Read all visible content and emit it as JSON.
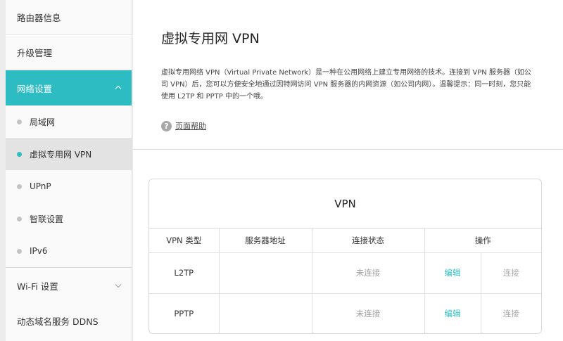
{
  "sidebar": {
    "items": [
      {
        "label": "路由器信息"
      },
      {
        "label": "升级管理"
      },
      {
        "label": "网络设置"
      },
      {
        "label": "Wi-Fi 设置"
      },
      {
        "label": "动态域名服务 DDNS"
      }
    ],
    "network_sub": [
      {
        "label": "局域网"
      },
      {
        "label": "虚拟专用网 VPN"
      },
      {
        "label": "UPnP"
      },
      {
        "label": "智联设置"
      },
      {
        "label": "IPv6"
      }
    ]
  },
  "main": {
    "title": "虚拟专用网 VPN",
    "description": "虚拟专用网络 VPN（Virtual Private Network）是一种在公用网络上建立专用网络的技术。连接到 VPN 服务器（如公司 VPN）后，您可以方便安全地通过因特网访问 VPN 服务器的内网资源（如公司内网）。温馨提示：同一时刻，您只能使用 L2TP 和 PPTP 中的一个哦。",
    "help_icon": "?",
    "help_label": "页面帮助",
    "panel_title": "VPN",
    "table": {
      "headers": [
        "VPN 类型",
        "服务器地址",
        "连接状态",
        "操作"
      ],
      "rows": [
        {
          "type": "L2TP",
          "server": "",
          "status": "未连接",
          "edit": "编辑",
          "connect": "连接"
        },
        {
          "type": "PPTP",
          "server": "",
          "status": "未连接",
          "edit": "编辑",
          "connect": "连接"
        }
      ]
    }
  },
  "colors": {
    "accent": "#2ebcc3",
    "muted_text": "#a0a0a0"
  }
}
